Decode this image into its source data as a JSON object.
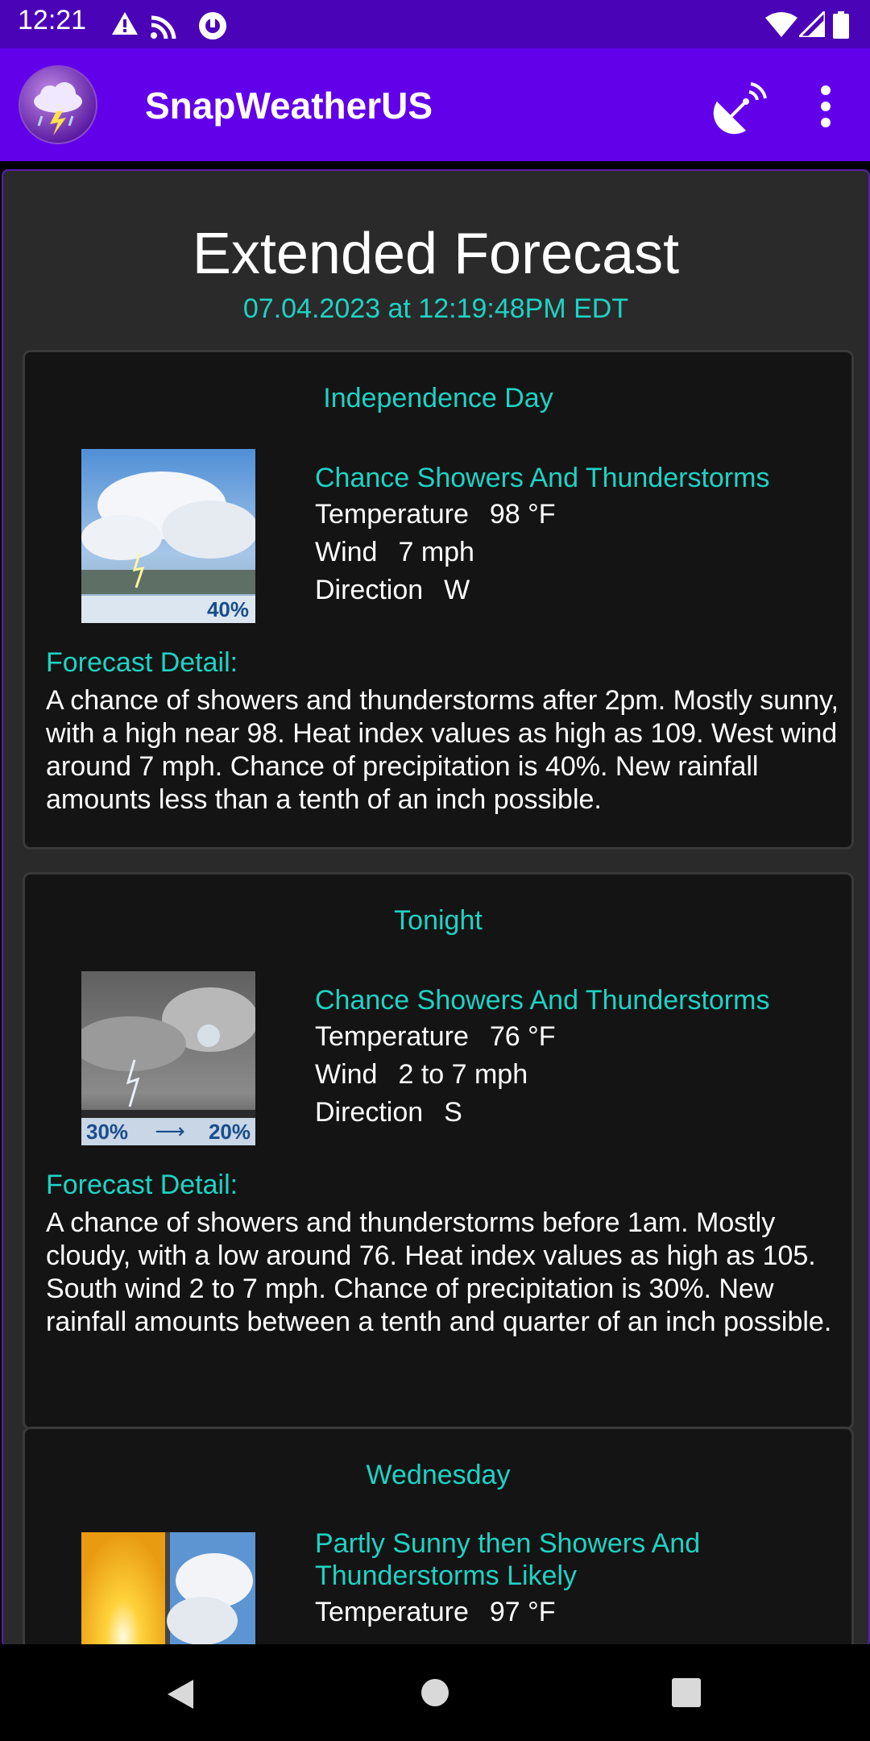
{
  "status_bar": {
    "time": "12:21",
    "icons": [
      "alert-icon",
      "cast-icon",
      "vpn-icon",
      "wifi-icon",
      "signal-icon",
      "battery-icon"
    ]
  },
  "app_bar": {
    "title": "SnapWeatherUS",
    "logo_icon": "storm-cloud-logo-icon",
    "actions": [
      "radar-dish-icon",
      "more-vert-icon"
    ]
  },
  "page": {
    "title": "Extended Forecast",
    "timestamp": "07.04.2023 at 12:19:48PM EDT"
  },
  "labels": {
    "temperature": "Temperature",
    "wind": "Wind",
    "direction": "Direction",
    "forecast_detail": "Forecast Detail:"
  },
  "forecasts": [
    {
      "period": "Independence Day",
      "short": "Chance Showers And Thunderstorms",
      "temperature": "98 °F",
      "wind": "7 mph",
      "direction": "W",
      "thumb_caption": "40%",
      "detail": "A chance of showers and thunderstorms after 2pm. Mostly sunny, with a high near 98. Heat index values as high as 109. West wind around 7 mph. Chance of precipitation is 40%. New rainfall amounts less than a tenth of an inch possible."
    },
    {
      "period": "Tonight",
      "short": "Chance Showers And Thunderstorms",
      "temperature": "76 °F",
      "wind": "2 to 7 mph",
      "direction": "S",
      "thumb_caption_left": "30%",
      "thumb_caption_right": "20%",
      "detail": "A chance of showers and thunderstorms before 1am. Mostly cloudy, with a low around 76. Heat index values as high as 105. South wind 2 to 7 mph. Chance of precipitation is 30%. New rainfall amounts between a tenth and quarter of an inch possible."
    },
    {
      "period": "Wednesday",
      "short": "Partly Sunny then Showers And Thunderstorms Likely",
      "temperature": "97 °F"
    }
  ],
  "nav_bar": {
    "icons": [
      "back-icon",
      "home-icon",
      "recents-icon"
    ]
  },
  "colors": {
    "status_bar": "#4a03b6",
    "app_bar": "#6200ea",
    "accent_teal": "#1ed3c4",
    "card_bg": "#141414",
    "content_bg": "#2a2a2a"
  }
}
